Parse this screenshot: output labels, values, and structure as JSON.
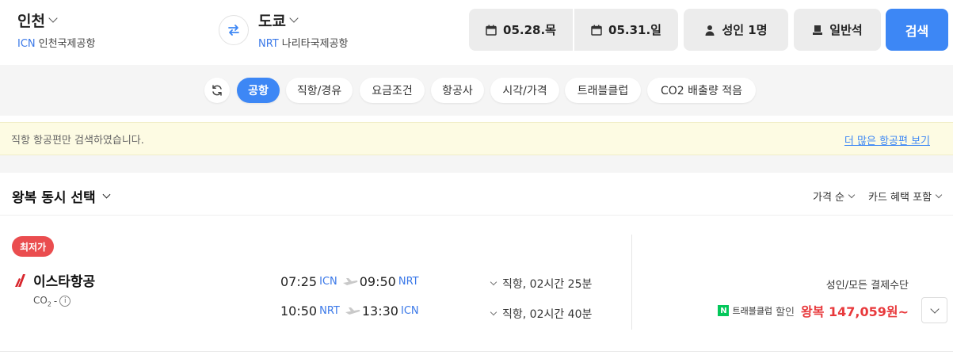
{
  "origin": {
    "city": "인천",
    "code": "ICN",
    "airport": "인천국제공항"
  },
  "destination": {
    "city": "도쿄",
    "code": "NRT",
    "airport": "나리타국제공항"
  },
  "dates": {
    "departure": "05.28.목",
    "return": "05.31.일"
  },
  "passengers": "성인 1명",
  "cabin": "일반석",
  "search_button": "검색",
  "filters": [
    "공항",
    "직항/경유",
    "요금조건",
    "항공사",
    "시각/가격",
    "트래블클럽",
    "CO2 배출량 적음"
  ],
  "active_filter": "공항",
  "notice": {
    "text": "직항 항공편만 검색하였습니다.",
    "link": "더 많은 항공편 보기"
  },
  "section": {
    "title": "왕복 동시 선택",
    "sort": "가격 순",
    "card": "카드 혜택 포함"
  },
  "result": {
    "badge": "최저가",
    "airline": "이스타항공",
    "co2_label": "CO",
    "co2_sub": "2",
    "co2_value": "-",
    "legs": [
      {
        "dep_time": "07:25",
        "dep_code": "ICN",
        "arr_time": "09:50",
        "arr_code": "NRT",
        "duration": "직항, 02시간 25분"
      },
      {
        "dep_time": "10:50",
        "dep_code": "NRT",
        "arr_time": "13:30",
        "arr_code": "ICN",
        "duration": "직항, 02시간 40분"
      }
    ],
    "pay_label": "성인/모든 결제수단",
    "club_badge": "N",
    "club_name": "트래블클럽",
    "discount": "할인",
    "price": "왕복 147,059원~"
  },
  "colors": {
    "accent": "#3d87f5",
    "price": "#e8393c",
    "badge": "#ea4d4f",
    "airline_logo": "#d8262d",
    "npay": "#03c75a"
  }
}
